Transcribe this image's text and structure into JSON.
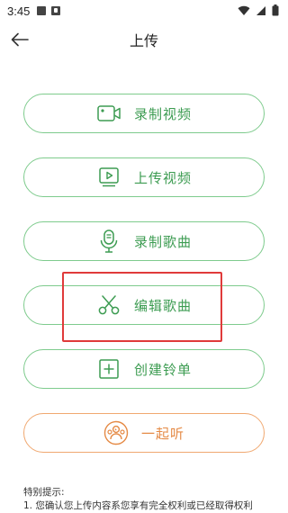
{
  "status_bar": {
    "time": "3:45"
  },
  "header": {
    "title": "上传"
  },
  "buttons": [
    {
      "label": "录制视频",
      "icon": "video-camera-icon",
      "color": "#3d9c52"
    },
    {
      "label": "上传视频",
      "icon": "play-video-icon",
      "color": "#3d9c52"
    },
    {
      "label": "录制歌曲",
      "icon": "microphone-icon",
      "color": "#3d9c52"
    },
    {
      "label": "编辑歌曲",
      "icon": "scissors-icon",
      "color": "#3d9c52"
    },
    {
      "label": "创建铃单",
      "icon": "add-box-icon",
      "color": "#3d9c52"
    },
    {
      "label": "一起听",
      "icon": "group-listen-icon",
      "color": "#e58a45"
    }
  ],
  "colors": {
    "green_border": "#7ecb8d",
    "green_text": "#3d9c52",
    "orange_border": "#f0a870",
    "orange_text": "#e58a45",
    "highlight": "#e03a3a"
  },
  "tips": {
    "title": "特别提示:",
    "line1": "1. 您确认您上传内容系您享有完全权利或已经取得权利"
  }
}
